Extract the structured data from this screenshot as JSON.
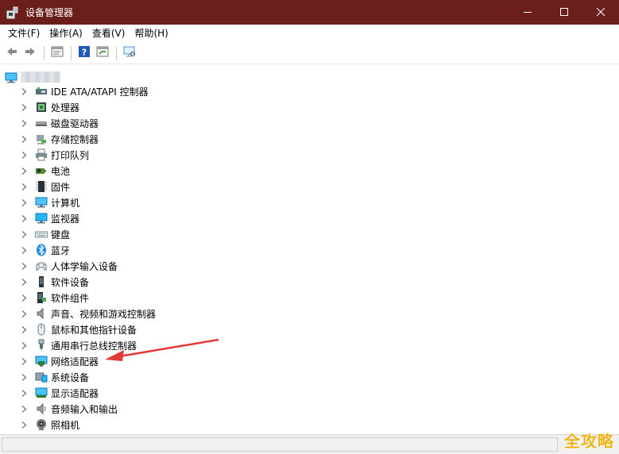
{
  "window": {
    "title": "设备管理器",
    "controls": {
      "minimize": "—",
      "maximize": "☐",
      "close": "✕"
    }
  },
  "menu": [
    "文件(F)",
    "操作(A)",
    "查看(V)",
    "帮助(H)"
  ],
  "toolbar": {
    "buttons": [
      "back-icon",
      "forward-icon",
      "properties-icon",
      "help-icon",
      "update-driver-icon",
      "scan-hardware-icon"
    ]
  },
  "tree": {
    "root_icon": "computer-icon",
    "categories": [
      {
        "label": "IDE ATA/ATAPI 控制器",
        "icon": "ide-controller-icon"
      },
      {
        "label": "处理器",
        "icon": "processor-icon"
      },
      {
        "label": "磁盘驱动器",
        "icon": "disk-drive-icon"
      },
      {
        "label": "存储控制器",
        "icon": "storage-controller-icon"
      },
      {
        "label": "打印队列",
        "icon": "printer-icon"
      },
      {
        "label": "电池",
        "icon": "battery-icon"
      },
      {
        "label": "固件",
        "icon": "firmware-icon"
      },
      {
        "label": "计算机",
        "icon": "computer-icon"
      },
      {
        "label": "监视器",
        "icon": "monitor-icon"
      },
      {
        "label": "键盘",
        "icon": "keyboard-icon"
      },
      {
        "label": "蓝牙",
        "icon": "bluetooth-icon"
      },
      {
        "label": "人体学输入设备",
        "icon": "hid-icon"
      },
      {
        "label": "软件设备",
        "icon": "software-device-icon"
      },
      {
        "label": "软件组件",
        "icon": "software-component-icon"
      },
      {
        "label": "声音、视频和游戏控制器",
        "icon": "sound-icon"
      },
      {
        "label": "鼠标和其他指针设备",
        "icon": "mouse-icon"
      },
      {
        "label": "通用串行总线控制器",
        "icon": "usb-icon"
      },
      {
        "label": "网络适配器",
        "icon": "network-adapter-icon"
      },
      {
        "label": "系统设备",
        "icon": "system-device-icon"
      },
      {
        "label": "显示适配器",
        "icon": "display-adapter-icon"
      },
      {
        "label": "音频输入和输出",
        "icon": "audio-io-icon"
      },
      {
        "label": "照相机",
        "icon": "camera-icon"
      }
    ]
  },
  "annotation": {
    "target": "网络适配器",
    "color": "#e53935"
  },
  "watermark": "全攻略",
  "colors": {
    "titlebar": "#6b1f1a",
    "accent": "#1e88e5"
  }
}
